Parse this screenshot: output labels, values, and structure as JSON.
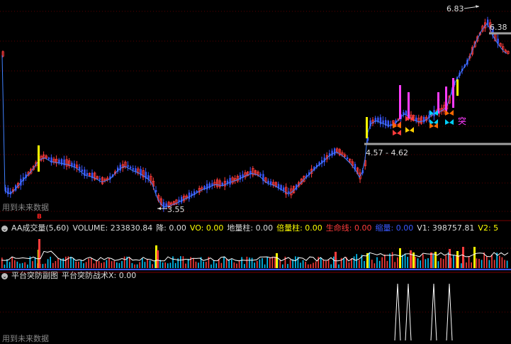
{
  "colors": {
    "up": "#ff3c3c",
    "down": "#3a58ff",
    "volume_up": "#ff3c3c",
    "volume_down": "#00c8ff",
    "yellow": "#ffff00",
    "magenta": "#ff3cff",
    "grid": "#5a0000",
    "separator": "#7a0000",
    "platform_line": "#a0a0a0",
    "ma_line": "#ffffff"
  },
  "main_chart": {
    "high_marker": "6.83",
    "platform_top": "6.38",
    "platform_range": "4.57 - 4.62",
    "low_marker": "3.55",
    "pattern_text": "突",
    "footer_note": "用到未来数据",
    "signal_marker": "B"
  },
  "volume_panel": {
    "collapse_icon": "panel-toggle-icon",
    "title": "AA成交量(5,60)",
    "fields": [
      {
        "label": "VOLUME: 233830.84",
        "color": "#dddddd"
      },
      {
        "label": "降: 0.00",
        "color": "#dddddd"
      },
      {
        "label": "VO: 0.00",
        "color": "#ffff00"
      },
      {
        "label": "地量柱: 0.00",
        "color": "#dddddd"
      },
      {
        "label": "倍量柱: 0.00",
        "color": "#ffff00"
      },
      {
        "label": "生命线: 0.00",
        "color": "#ff3c3c"
      },
      {
        "label": "缩量: 0.00",
        "color": "#3a58ff"
      },
      {
        "label": "V1: 398757.81",
        "color": "#dddddd"
      },
      {
        "label": "V2: 5",
        "color": "#ffff00"
      }
    ]
  },
  "indicator_panel": {
    "collapse_icon": "panel-toggle-icon",
    "title": "平台突防副图",
    "field": "平台突防战术X: 0.00",
    "footer_note": "用到未来数据"
  }
}
